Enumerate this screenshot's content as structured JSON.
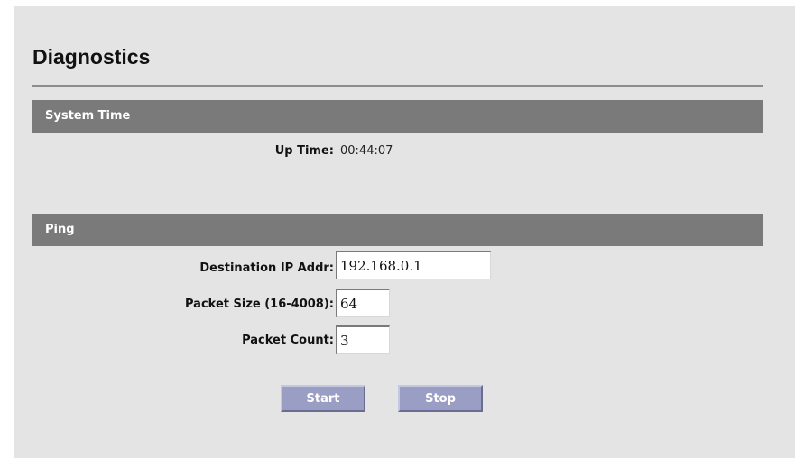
{
  "page": {
    "title": "Diagnostics"
  },
  "system_time": {
    "section_title": "System Time",
    "uptime_label": "Up Time:",
    "uptime_value": "00:44:07"
  },
  "ping": {
    "section_title": "Ping",
    "destination_label": "Destination IP Addr:",
    "destination_value": "192.168.0.1",
    "packet_size_label": "Packet Size (16-4008):",
    "packet_size_value": "64",
    "packet_count_label": "Packet Count:",
    "packet_count_value": "3",
    "start_label": "Start",
    "stop_label": "Stop"
  },
  "colors": {
    "background": "#e4e4e4",
    "section_bar": "#7a7a7a",
    "button": "#9a9ec4"
  }
}
